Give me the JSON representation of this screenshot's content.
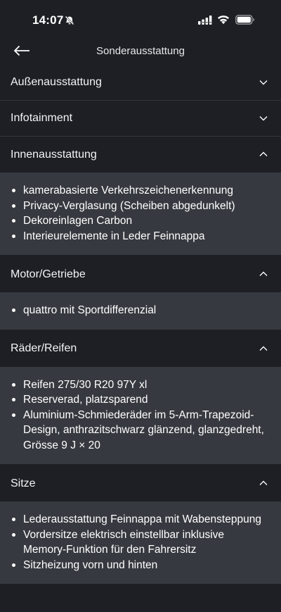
{
  "status_bar": {
    "time": "14:07",
    "icons": [
      "bell-slash-icon",
      "signal-icon",
      "wifi-icon",
      "battery-icon"
    ]
  },
  "nav": {
    "title": "Sonderausstattung",
    "back_icon": "arrow-left-icon"
  },
  "sections": [
    {
      "title": "Außenausstattung",
      "expanded": false,
      "items": []
    },
    {
      "title": "Infotainment",
      "expanded": false,
      "items": []
    },
    {
      "title": "Innenausstattung",
      "expanded": true,
      "items": [
        "kamerabasierte Verkehrszeichenerkennung",
        "Privacy-Verglasung (Scheiben abgedunkelt)",
        "Dekoreinlagen Carbon",
        "Interieurelemente in Leder Feinnappa"
      ]
    },
    {
      "title": "Motor/Getriebe",
      "expanded": true,
      "items": [
        "quattro mit Sportdifferenzial"
      ]
    },
    {
      "title": "Räder/Reifen",
      "expanded": true,
      "items": [
        "Reifen 275/30 R20 97Y xl",
        "Reserverad, platzsparend",
        "Aluminium-Schmiederäder im 5-Arm-Trapezoid-Design, anthrazitschwarz glänzend, glanzgedreht, Grösse 9 J × 20"
      ]
    },
    {
      "title": "Sitze",
      "expanded": true,
      "items": [
        "Lederausstattung Feinnappa mit Wabensteppung",
        "Vordersitze elektrisch einstellbar inklusive Memory-Funktion für den Fahrersitz",
        "Sitzheizung vorn und hinten"
      ]
    }
  ],
  "colors": {
    "background": "#1d1f24",
    "panel": "#36393f",
    "divider": "#33363c",
    "text": "#ffffff"
  }
}
